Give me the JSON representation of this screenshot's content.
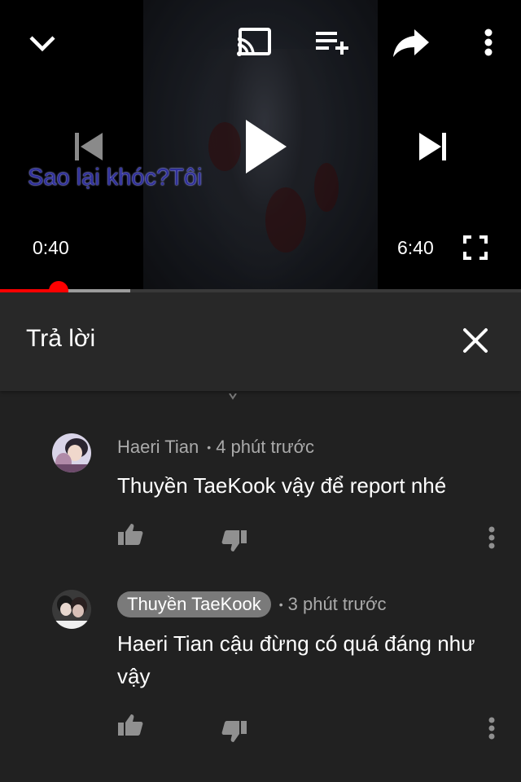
{
  "player": {
    "current_time": "0:40",
    "duration": "6:40",
    "caption": "Sao lại khóc?Tôi",
    "progress_played": 0.1125,
    "progress_buffered": 0.25,
    "colors": {
      "progress": "#ff0000",
      "buffer": "#9e9e9e"
    },
    "icons": [
      "collapse-chevron-icon",
      "cast-icon",
      "add-to-queue-icon",
      "share-icon",
      "more-vert-icon",
      "previous-icon",
      "play-icon",
      "next-icon",
      "fullscreen-icon"
    ]
  },
  "reply_panel": {
    "title": "Trả lời",
    "close_icon": "close-icon"
  },
  "comments": [
    {
      "author": "Haeri Tian",
      "time": "4 phút trước",
      "text": "Thuyền TaeKook vậy để report nhé",
      "author_is_owner": false
    },
    {
      "author": "Thuyền TaeKook",
      "time": "3 phút trước",
      "text": "Haeri Tian cậu đừng có quá đáng như vậy",
      "author_is_owner": true
    }
  ]
}
